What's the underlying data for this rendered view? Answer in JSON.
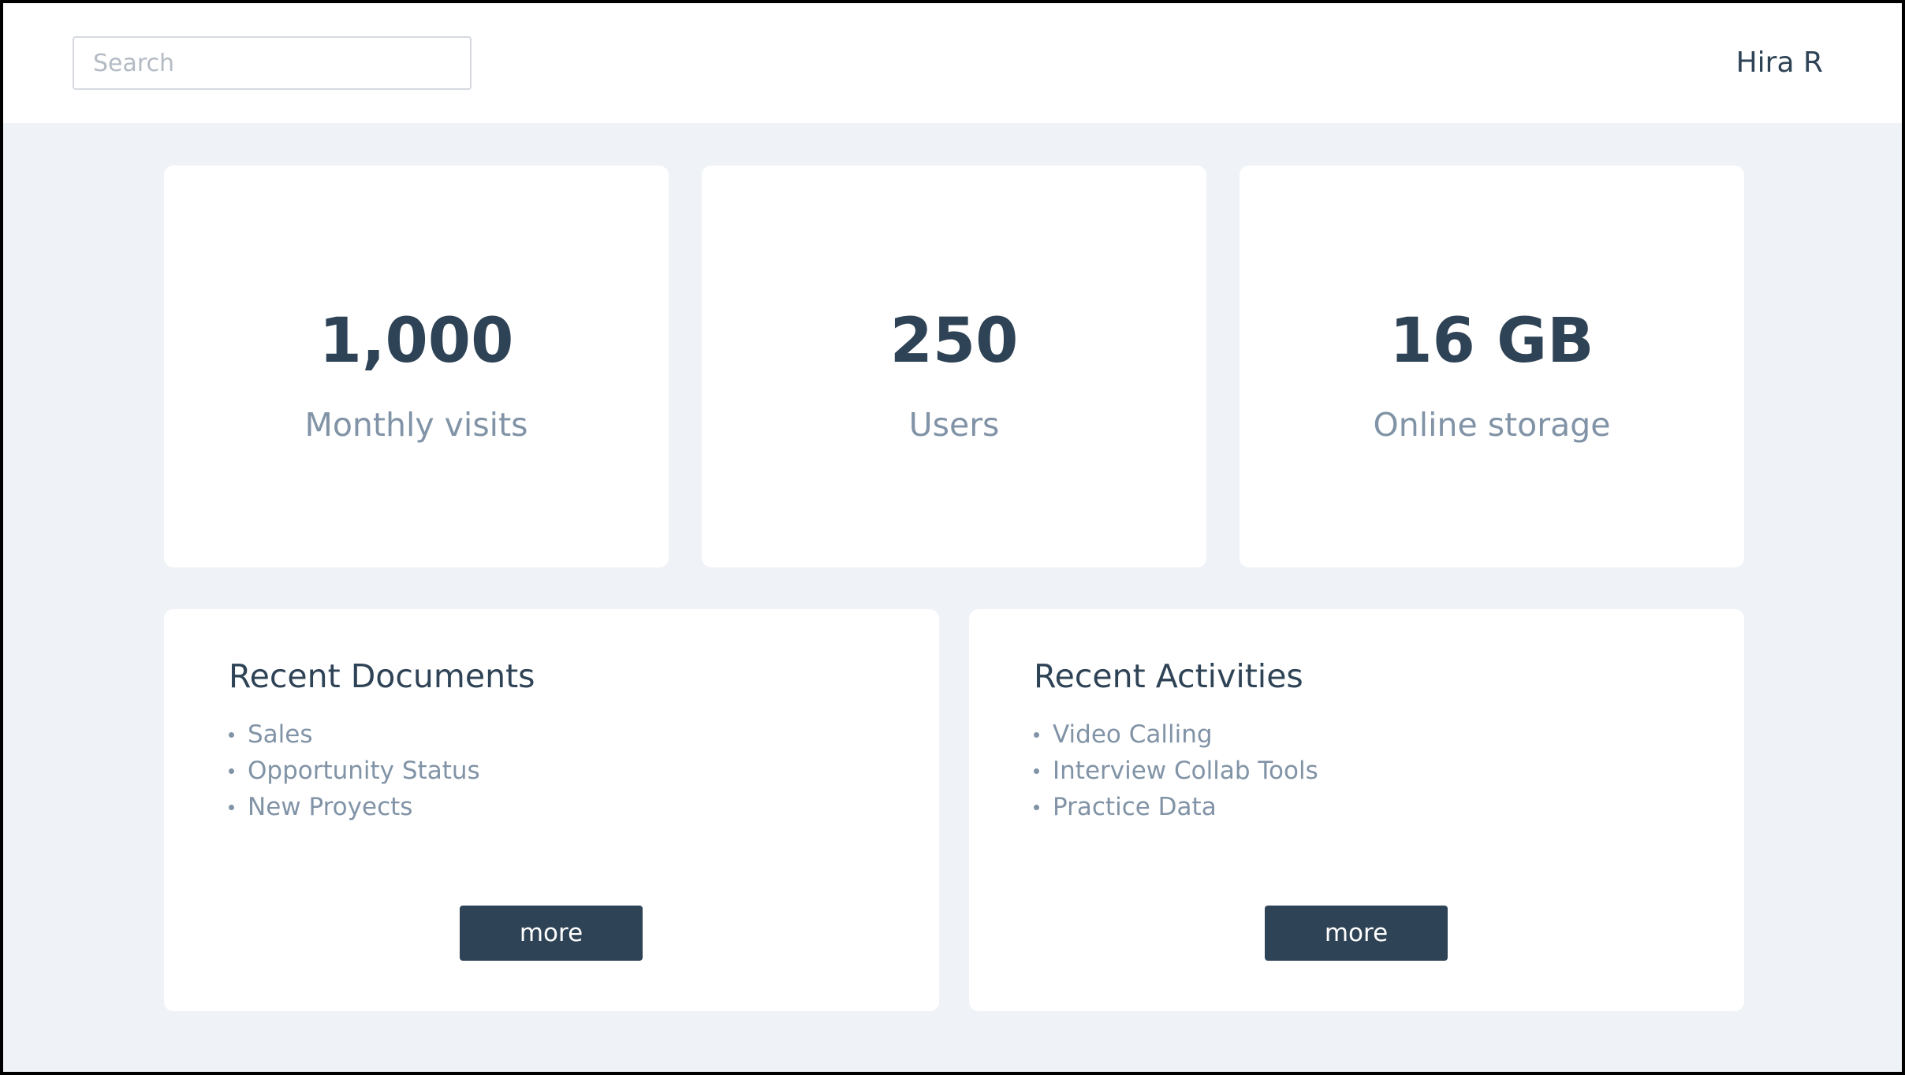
{
  "header": {
    "search_placeholder": "Search",
    "user_name": "Hira R"
  },
  "stats": [
    {
      "value": "1,000",
      "label": "Monthly visits"
    },
    {
      "value": "250",
      "label": "Users"
    },
    {
      "value": "16 GB",
      "label": "Online storage"
    }
  ],
  "recent_documents": {
    "title": "Recent Documents",
    "items": [
      "Sales",
      "Opportunity Status",
      "New Proyects"
    ],
    "button_label": "more"
  },
  "recent_activities": {
    "title": "Recent Activities",
    "items": [
      "Video Calling",
      "Interview Collab Tools",
      "Practice Data"
    ],
    "button_label": "more"
  },
  "colors": {
    "background": "#eff2f6",
    "card": "#ffffff",
    "primary_text": "#2f4356",
    "secondary_text": "#8193a6",
    "button": "#2f4356",
    "button_text": "#ffffff"
  }
}
